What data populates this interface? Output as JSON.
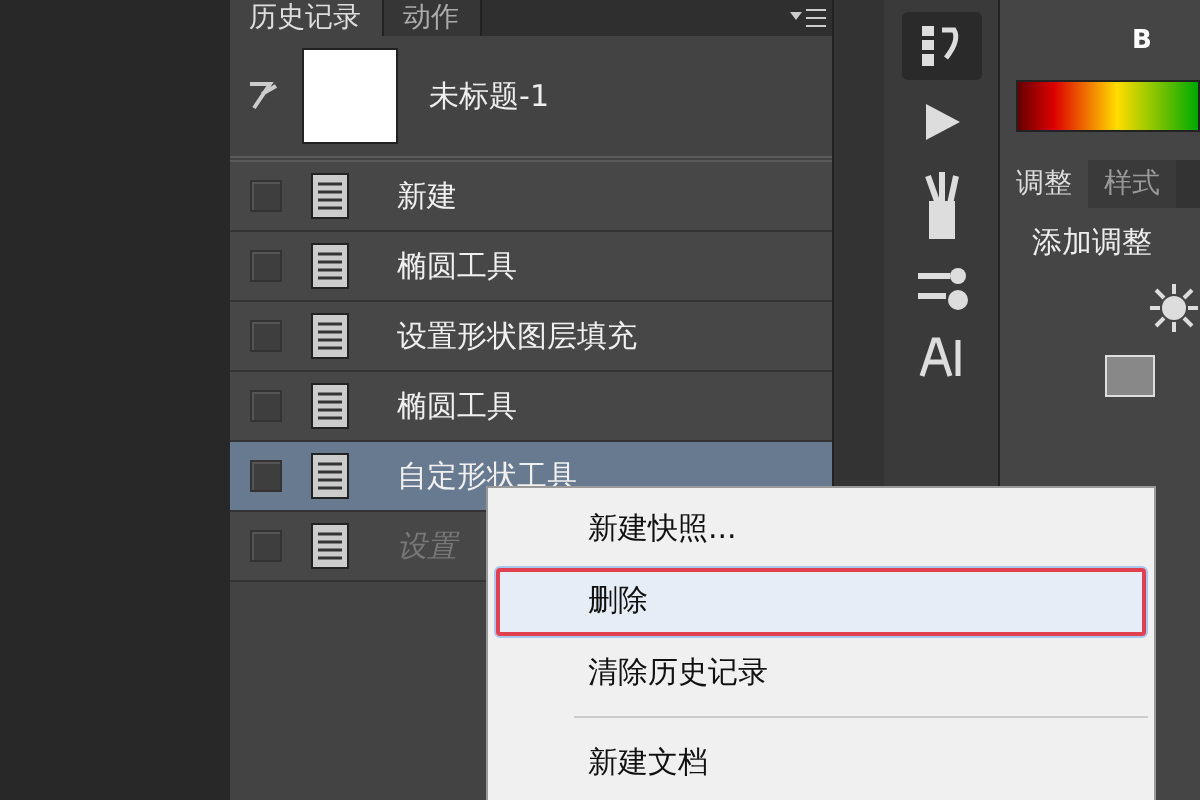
{
  "history_panel": {
    "tabs": [
      {
        "label": "历史记录",
        "selected": true
      },
      {
        "label": "动作",
        "selected": false
      }
    ],
    "snapshot": {
      "label": "未标题-1"
    },
    "states": [
      {
        "label": "新建",
        "selected": false,
        "disabled": false
      },
      {
        "label": "椭圆工具",
        "selected": false,
        "disabled": false
      },
      {
        "label": "设置形状图层填充",
        "selected": false,
        "disabled": false
      },
      {
        "label": "椭圆工具",
        "selected": false,
        "disabled": false
      },
      {
        "label": "自定形状工具",
        "selected": true,
        "disabled": false
      },
      {
        "label": "设置",
        "selected": false,
        "disabled": true
      }
    ]
  },
  "right_panel": {
    "channel": "B",
    "tabs": [
      {
        "label": "调整",
        "selected": true
      },
      {
        "label": "样式",
        "selected": false
      }
    ],
    "heading": "添加调整"
  },
  "context_menu": {
    "items": [
      {
        "label": "新建快照...",
        "highlighted": false,
        "separator_before": false
      },
      {
        "label": "删除",
        "highlighted": true,
        "separator_before": false
      },
      {
        "label": "清除历史记录",
        "highlighted": false,
        "separator_before": false
      },
      {
        "label": "新建文档",
        "highlighted": false,
        "separator_before": true
      }
    ]
  }
}
